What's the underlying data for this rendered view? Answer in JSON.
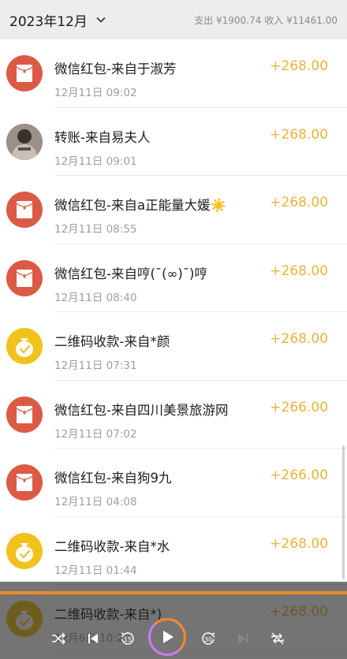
{
  "header": {
    "month": "2023年12月",
    "expense": "支出 ¥1900.74",
    "income": "收入 ¥11461.00"
  },
  "transactions": [
    {
      "title": "微信红包-来自于淑芳",
      "time": "12月11日 09:02",
      "amount": "+268.00",
      "icon": "red-packet-icon"
    },
    {
      "title": "转账-来自易夫人",
      "time": "12月11日 09:01",
      "amount": "+268.00",
      "icon": "avatar"
    },
    {
      "title": "微信红包-来自a正能量大媛☀️",
      "time": "12月11日 08:55",
      "amount": "+268.00",
      "icon": "red-packet-icon"
    },
    {
      "title": "微信红包-来自哼(ˉ(∞)ˉ)哼",
      "time": "12月11日 08:40",
      "amount": "+268.00",
      "icon": "red-packet-icon"
    },
    {
      "title": "二维码收款-来自*颜",
      "time": "12月11日 07:31",
      "amount": "+268.00",
      "icon": "qr-money-bag-icon"
    },
    {
      "title": "微信红包-来自四川美景旅游网",
      "time": "12月11日 07:02",
      "amount": "+266.00",
      "icon": "red-packet-icon"
    },
    {
      "title": "微信红包-来自狗9九",
      "time": "12月11日 04:08",
      "amount": "+266.00",
      "icon": "red-packet-icon"
    },
    {
      "title": "二维码收款-来自*水",
      "time": "12月11日 01:44",
      "amount": "+268.00",
      "icon": "qr-money-bag-icon"
    },
    {
      "title": "二维码收款-来自*)",
      "time": "12月6日 10:2",
      "amount": "+268.00",
      "icon": "qr-money-bag-icon"
    }
  ],
  "colors": {
    "amount": "#e9b43b",
    "red_packet": "#dc5a45",
    "qr_bag": "#f0c21c",
    "progress": "#f08a2a"
  },
  "player": {
    "progress": 1.0,
    "skip_back_label": "15",
    "skip_forward_label": "30"
  }
}
